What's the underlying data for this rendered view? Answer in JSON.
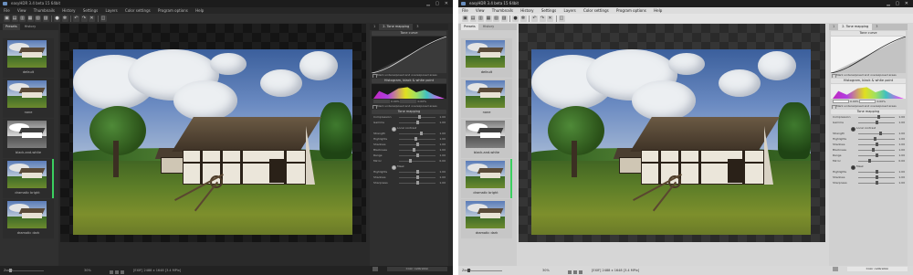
{
  "window_title": "easyHDR 3.4 beta 15 64bit",
  "menu": [
    "File",
    "View",
    "Thumbnails",
    "History",
    "Settings",
    "Layers",
    "Color settings",
    "Program options",
    "Help"
  ],
  "left_tabs": [
    "Presets",
    "History"
  ],
  "presets": [
    {
      "label": "default"
    },
    {
      "label": "none"
    },
    {
      "label": "black-and-white"
    },
    {
      "label": "dramatic bright"
    },
    {
      "label": "dramatic dark"
    }
  ],
  "right_tabs": [
    "1",
    "2. Tone mapping",
    "3"
  ],
  "tone_curve": {
    "title": "Tone curve"
  },
  "checks": {
    "first": "Mark underexposed and overexposed areas",
    "second": "Mark underexposed and overexposed areas"
  },
  "histogram": {
    "title": "Histogram, black & white point",
    "values": [
      "0.00%",
      "0.00%"
    ]
  },
  "tone_mapping": {
    "title": "Tone mapping"
  },
  "sliders": [
    {
      "label": "Compression",
      "value": "1.00",
      "pos": 0.55
    },
    {
      "label": "Gamma",
      "value": "1.00",
      "pos": 0.5
    },
    {
      "label": "Strength",
      "value": "1.00",
      "pos": 0.6
    },
    {
      "label": "Highlights",
      "value": "1.00",
      "pos": 0.45
    },
    {
      "label": "Shadows",
      "value": "1.00",
      "pos": 0.5
    },
    {
      "label": "Blackness",
      "value": "1.00",
      "pos": 0.4
    },
    {
      "label": "Range",
      "value": "1.00",
      "pos": 0.5
    },
    {
      "label": "Mirror",
      "value": "0.00",
      "pos": 0.3
    }
  ],
  "mask_sliders": [
    {
      "label": "Highlights",
      "value": "1.00",
      "pos": 0.5
    },
    {
      "label": "Shadows",
      "value": "1.00",
      "pos": 0.5
    },
    {
      "label": "Sharpness",
      "value": "1.00",
      "pos": 0.5
    }
  ],
  "radio": {
    "local_contrast": "Local contrast",
    "mask": "Mask"
  },
  "color_calibration": {
    "label": "Color calibration"
  },
  "statusbar": {
    "zoom_label": "Zoom",
    "zoom_value": "30%",
    "info": "[EXIF] 2488 x 1648 [3.4 MPix]"
  },
  "colors": {
    "accent_green": "#3ad060",
    "dark_bg": "#2a2a2a",
    "light_bg": "#d6d6d6"
  }
}
